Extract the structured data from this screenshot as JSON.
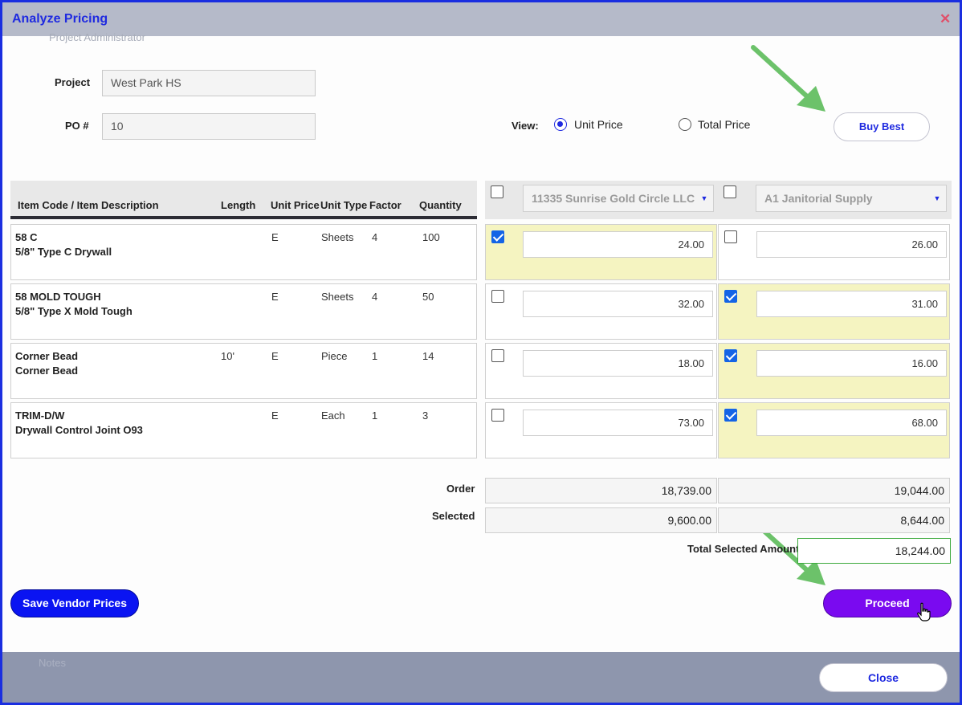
{
  "dialog": {
    "title": "Analyze Pricing",
    "close_icon": "close-icon",
    "ghost_header": "Project Administrator",
    "ghost_footer": "Notes"
  },
  "form": {
    "project_label": "Project",
    "project_value": "West Park HS",
    "po_label": "PO #",
    "po_value": "10",
    "view_label": "View:",
    "view_options": [
      {
        "label": "Unit Price",
        "selected": true
      },
      {
        "label": "Total Price",
        "selected": false
      }
    ],
    "buy_best_label": "Buy Best"
  },
  "table": {
    "columns": [
      "Item Code / Item Description",
      "Length",
      "Unit Price",
      "Unit Type",
      "Factor",
      "Quantity"
    ],
    "rows": [
      {
        "code": "58 C",
        "description": "5/8\" Type C Drywall",
        "length": "",
        "unit_price": "E",
        "unit_type": "Sheets",
        "factor": "4",
        "quantity": "100"
      },
      {
        "code": "58 MOLD TOUGH",
        "description": "5/8\" Type X Mold Tough",
        "length": "",
        "unit_price": "E",
        "unit_type": "Sheets",
        "factor": "4",
        "quantity": "50"
      },
      {
        "code": "Corner Bead",
        "description": "Corner Bead",
        "length": "10'",
        "unit_price": "E",
        "unit_type": "Piece",
        "factor": "1",
        "quantity": "14"
      },
      {
        "code": "TRIM-D/W",
        "description": "Drywall Control Joint O93",
        "length": "",
        "unit_price": "E",
        "unit_type": "Each",
        "factor": "1",
        "quantity": "3"
      }
    ]
  },
  "vendors": [
    {
      "name": "11335 Sunrise Gold Circle LLC",
      "header_checked": false,
      "prices": [
        "24.00",
        "32.00",
        "18.00",
        "73.00"
      ],
      "checked": [
        true,
        false,
        false,
        false
      ],
      "order_total": "18,739.00",
      "selected_total": "9,600.00"
    },
    {
      "name": "A1 Janitorial Supply",
      "header_checked": false,
      "prices": [
        "26.00",
        "31.00",
        "16.00",
        "68.00"
      ],
      "checked": [
        false,
        true,
        true,
        true
      ],
      "order_total": "19,044.00",
      "selected_total": "8,644.00"
    }
  ],
  "summary": {
    "order_label": "Order",
    "selected_label": "Selected",
    "total_label": "Total Selected Amount",
    "total_value": "18,244.00"
  },
  "actions": {
    "save_label": "Save Vendor Prices",
    "proceed_label": "Proceed",
    "close_label": "Close"
  },
  "colors": {
    "accent": "#1f2ae0",
    "proceed": "#7a0af0",
    "selected_cell": "#f5f4c1",
    "arrow": "#6cc26a"
  }
}
